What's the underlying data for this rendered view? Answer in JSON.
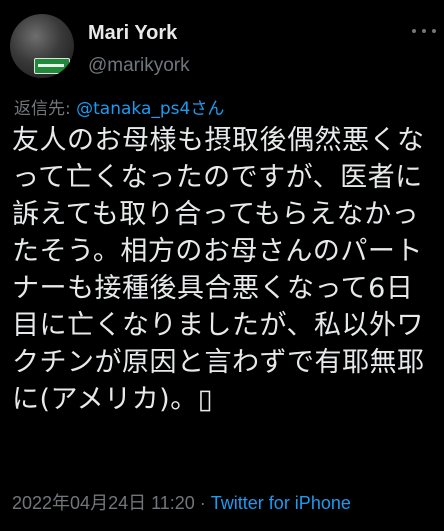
{
  "author": {
    "display_name": "Mari York",
    "handle": "@marikyork",
    "avatar_icon": "avatar-photo-icon"
  },
  "reply": {
    "prefix": "返信先: ",
    "mention": "@tanaka_ps4さん"
  },
  "tweet": {
    "text": "友人のお母様も摂取後偶然悪くなって亡くなったのですが、医者に訴えても取り合ってもらえなかったそう。相方のお母さんのパートナーも接種後具合悪くなって6日目に亡くなりましたが、私以外ワクチンが原因と言わずで有耶無耶に(アメリカ)。▯"
  },
  "meta": {
    "timestamp": "2022年04月24日 11:20",
    "separator": " · ",
    "source": "Twitter for iPhone"
  },
  "colors": {
    "background": "#000000",
    "text": "#e7e9ea",
    "secondary": "#71767b",
    "link": "#1d9bf0"
  }
}
